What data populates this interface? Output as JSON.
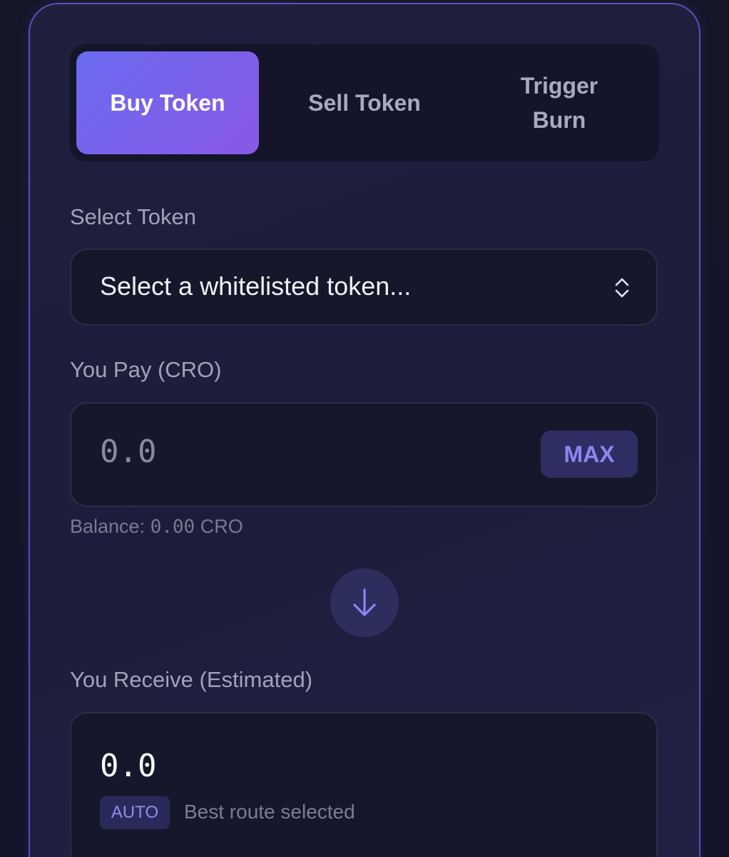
{
  "tabs": [
    {
      "label": "Buy Token",
      "active": true
    },
    {
      "label": "Sell Token",
      "active": false
    },
    {
      "label_line1": "Trigger",
      "label_line2": "Burn",
      "active": false
    }
  ],
  "select_token": {
    "label": "Select Token",
    "placeholder": "Select a whitelisted token..."
  },
  "pay": {
    "label": "You Pay (CRO)",
    "placeholder": "0.0",
    "max_label": "MAX",
    "balance_prefix": "Balance:",
    "balance_value": "0.00",
    "balance_unit": "CRO"
  },
  "swap_icon": "arrow-down-icon",
  "receive": {
    "label": "You Receive (Estimated)",
    "value": "0.0",
    "badge": "AUTO",
    "route_text": "Best route selected"
  },
  "colors": {
    "accent_start": "#6a6cf0",
    "accent_end": "#8a58e6",
    "card_border": "#5b4fb8",
    "max_text": "#8a86f2"
  }
}
